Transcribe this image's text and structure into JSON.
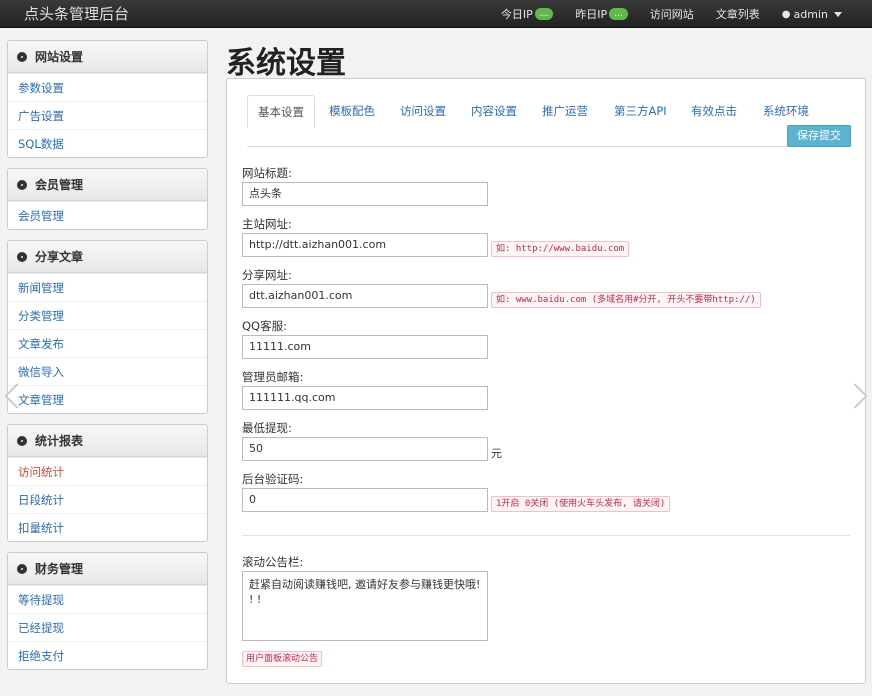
{
  "app": {
    "brand": "点头条管理后台"
  },
  "topnav": {
    "today_ip": "今日IP",
    "today_ip_badge": "...",
    "yesterday_ip": "昨日IP",
    "yesterday_ip_badge": "...",
    "visit_site": "访问网站",
    "article_list": "文章列表",
    "user": "admin"
  },
  "sidebar": {
    "site_settings": {
      "title": "网站设置",
      "items": [
        "参数设置",
        "广告设置",
        "SQL数据"
      ]
    },
    "members": {
      "title": "会员管理",
      "items": [
        "会员管理"
      ]
    },
    "share": {
      "title": "分享文章",
      "items": [
        "新闻管理",
        "分类管理",
        "文章发布",
        "微信导入",
        "文章管理"
      ]
    },
    "stats": {
      "title": "统计报表",
      "items": [
        "访问统计",
        "日段统计",
        "扣量统计"
      ]
    },
    "finance": {
      "title": "财务管理",
      "items": [
        "等待提现",
        "已经提现",
        "拒绝支付"
      ]
    }
  },
  "page": {
    "title": "系统设置"
  },
  "tabs": [
    "基本设置",
    "模板配色",
    "访问设置",
    "内容设置",
    "推广运营",
    "第三方API",
    "有效点击",
    "系统环境"
  ],
  "save_label": "保存提交",
  "form": {
    "site_title": {
      "label": "网站标题:",
      "value": "点头条"
    },
    "main_url": {
      "label": "主站网址:",
      "value": "http://dtt.aizhan001.com",
      "hint": "如: http://www.baidu.com"
    },
    "share_url": {
      "label": "分享网址:",
      "value": "dtt.aizhan001.com",
      "hint": "如: www.baidu.com (多域名用#分开, 开头不要带http://)"
    },
    "qq": {
      "label": "QQ客服:",
      "value": "11111.com"
    },
    "email": {
      "label": "管理员邮箱:",
      "value": "111111.qq.com"
    },
    "min_withdraw": {
      "label": "最低提现:",
      "value": "50",
      "unit": "元"
    },
    "captcha": {
      "label": "后台验证码:",
      "value": "0",
      "hint": "1开启 0关闭 (使用火车头发布, 请关闭)"
    },
    "notice": {
      "label": "滚动公告栏:",
      "value": "赶紧自动阅读赚钱吧, 邀请好友参与赚钱更快哦! ! !",
      "hint": "用户面板滚动公告"
    }
  }
}
